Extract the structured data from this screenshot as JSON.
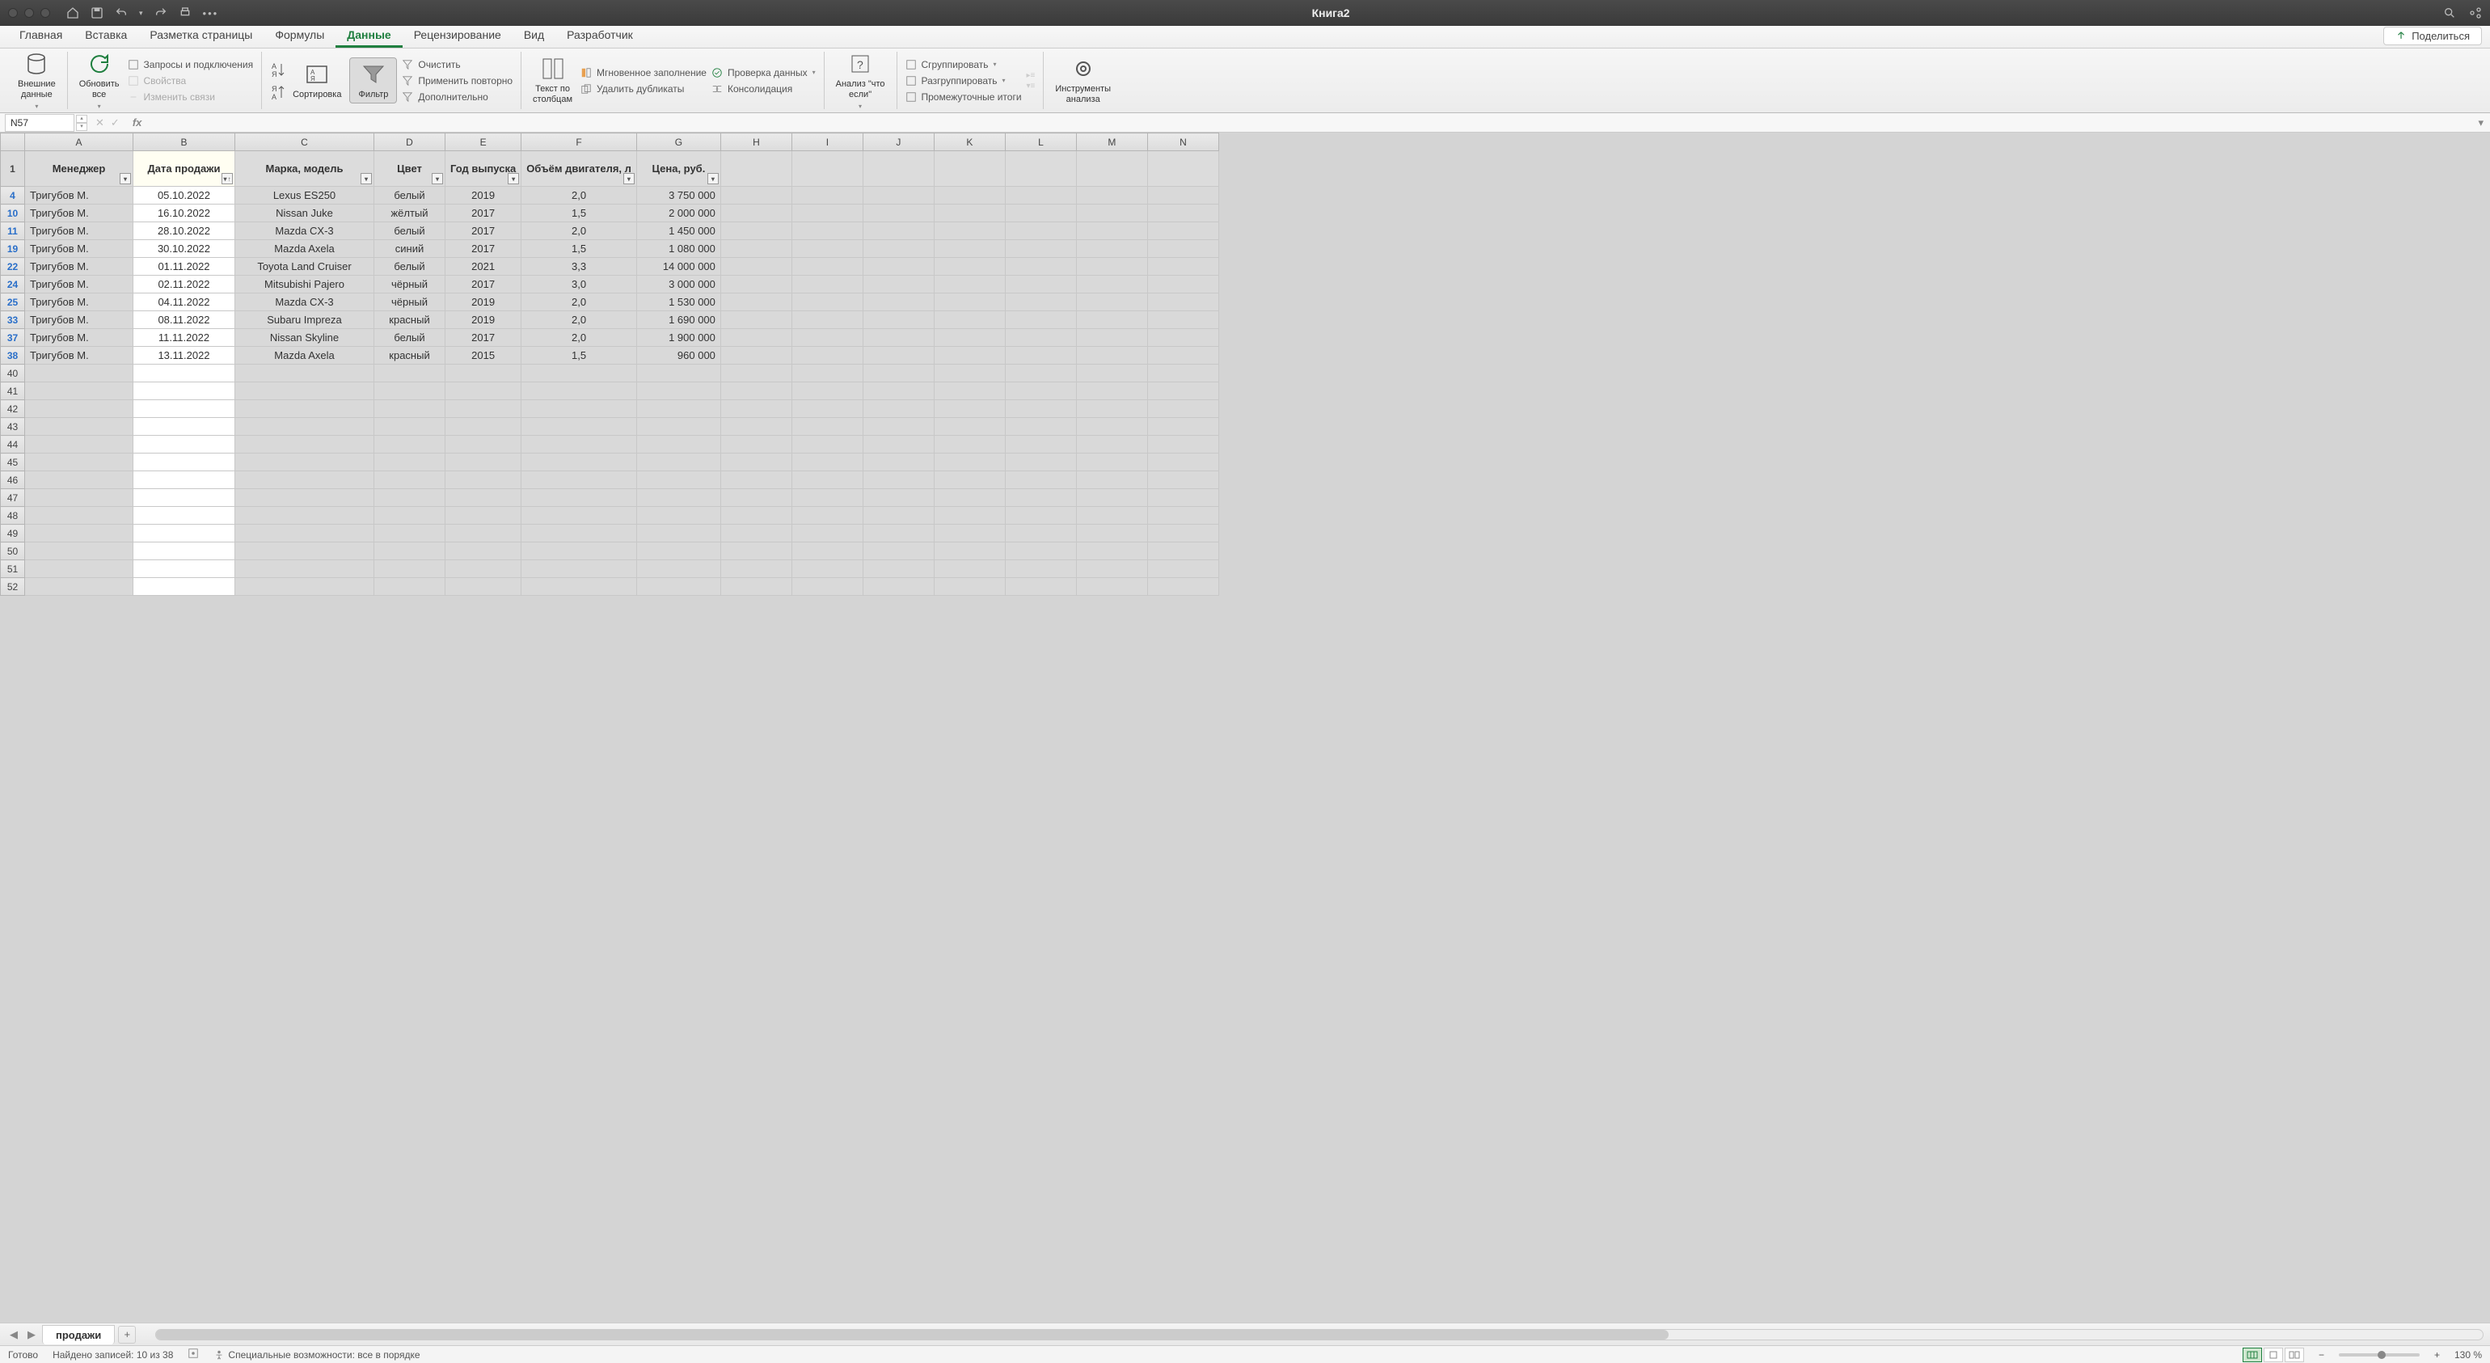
{
  "title": "Книга2",
  "titlebar": {
    "search_title": "поиск",
    "share_title": "поделиться"
  },
  "tabs": [
    "Главная",
    "Вставка",
    "Разметка страницы",
    "Формулы",
    "Данные",
    "Рецензирование",
    "Вид",
    "Разработчик"
  ],
  "active_tab_index": 4,
  "share_label": "Поделиться",
  "ribbon": {
    "external_data": "Внешние\nданные",
    "refresh_all": "Обновить\nвсе",
    "queries": "Запросы и подключения",
    "properties": "Свойства",
    "edit_links": "Изменить связи",
    "sort": "Сортировка",
    "filter": "Фильтр",
    "clear": "Очистить",
    "reapply": "Применить повторно",
    "advanced": "Дополнительно",
    "text_to_cols": "Текст по\nстолбцам",
    "flash_fill": "Мгновенное заполнение",
    "remove_dup": "Удалить дубликаты",
    "data_valid": "Проверка данных",
    "consolidate": "Консолидация",
    "whatif": "Анализ \"что\nесли\"",
    "group": "Сгруппировать",
    "ungroup": "Разгруппировать",
    "subtotal": "Промежуточные итоги",
    "analysis": "Инструменты\nанализа"
  },
  "namebox": "N57",
  "formula": "",
  "columns": [
    "A",
    "B",
    "C",
    "D",
    "E",
    "F",
    "G",
    "H",
    "I",
    "J",
    "K",
    "L",
    "M",
    "N"
  ],
  "headers": [
    "Менеджер",
    "Дата продажи",
    "Марка, модель",
    "Цвет",
    "Год выпуска",
    "Объём двигателя, л",
    "Цена, руб."
  ],
  "row_numbers": [
    4,
    10,
    11,
    19,
    22,
    24,
    25,
    33,
    37,
    38,
    40,
    41,
    42,
    43,
    44,
    45,
    46,
    47,
    48,
    49,
    50,
    51,
    52
  ],
  "data_rows": [
    {
      "manager": "Тригубов М.",
      "date": "05.10.2022",
      "model": "Lexus ES250",
      "color": "белый",
      "year": "2019",
      "engine": "2,0",
      "price": "3 750 000"
    },
    {
      "manager": "Тригубов М.",
      "date": "16.10.2022",
      "model": "Nissan Juke",
      "color": "жёлтый",
      "year": "2017",
      "engine": "1,5",
      "price": "2 000 000"
    },
    {
      "manager": "Тригубов М.",
      "date": "28.10.2022",
      "model": "Mazda CX-3",
      "color": "белый",
      "year": "2017",
      "engine": "2,0",
      "price": "1 450 000"
    },
    {
      "manager": "Тригубов М.",
      "date": "30.10.2022",
      "model": "Mazda Axela",
      "color": "синий",
      "year": "2017",
      "engine": "1,5",
      "price": "1 080 000"
    },
    {
      "manager": "Тригубов М.",
      "date": "01.11.2022",
      "model": "Toyota Land Cruiser",
      "color": "белый",
      "year": "2021",
      "engine": "3,3",
      "price": "14 000 000"
    },
    {
      "manager": "Тригубов М.",
      "date": "02.11.2022",
      "model": "Mitsubishi Pajero",
      "color": "чёрный",
      "year": "2017",
      "engine": "3,0",
      "price": "3 000 000"
    },
    {
      "manager": "Тригубов М.",
      "date": "04.11.2022",
      "model": "Mazda CX-3",
      "color": "чёрный",
      "year": "2019",
      "engine": "2,0",
      "price": "1 530 000"
    },
    {
      "manager": "Тригубов М.",
      "date": "08.11.2022",
      "model": "Subaru Impreza",
      "color": "красный",
      "year": "2019",
      "engine": "2,0",
      "price": "1 690 000"
    },
    {
      "manager": "Тригубов М.",
      "date": "11.11.2022",
      "model": "Nissan Skyline",
      "color": "белый",
      "year": "2017",
      "engine": "2,0",
      "price": "1 900 000"
    },
    {
      "manager": "Тригубов М.",
      "date": "13.11.2022",
      "model": "Mazda Axela",
      "color": "красный",
      "year": "2015",
      "engine": "1,5",
      "price": "960 000"
    }
  ],
  "sheet_tab": "продажи",
  "status": {
    "ready": "Готово",
    "found": "Найдено записей: 10 из 38",
    "accessibility": "Специальные возможности: все в порядке",
    "zoom": "130 %"
  }
}
